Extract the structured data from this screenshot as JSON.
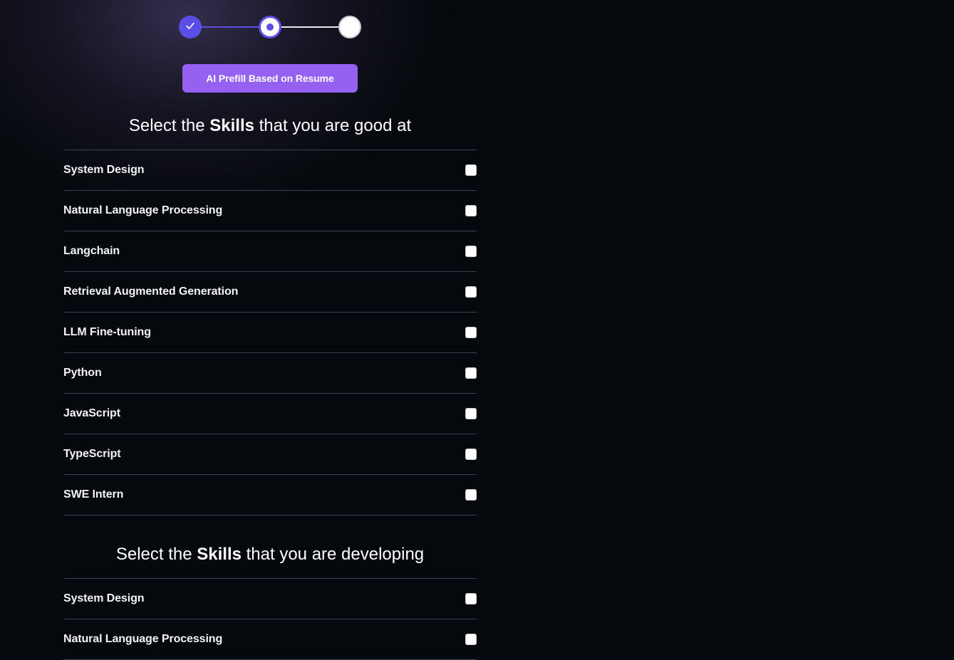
{
  "stepper": {
    "steps": [
      {
        "status": "complete",
        "icon": "check-icon"
      },
      {
        "status": "current",
        "icon": "dot-icon"
      },
      {
        "status": "upcoming",
        "icon": ""
      }
    ],
    "current_step": 2,
    "total_steps": 3
  },
  "prefill_button": {
    "label": "AI Prefill Based on Resume"
  },
  "colors": {
    "accent": "#5b4ee6",
    "button": "#9461f0",
    "background": "#05080c",
    "divider": "#3a4150"
  },
  "sections": [
    {
      "title_prefix": "Select the ",
      "title_bold": "Skills",
      "title_suffix": " that you are good at",
      "skills": [
        {
          "label": "System Design",
          "checked": false
        },
        {
          "label": "Natural Language Processing",
          "checked": false
        },
        {
          "label": "Langchain",
          "checked": false
        },
        {
          "label": "Retrieval Augmented Generation",
          "checked": false
        },
        {
          "label": "LLM Fine-tuning",
          "checked": false
        },
        {
          "label": "Python",
          "checked": false
        },
        {
          "label": "JavaScript",
          "checked": false
        },
        {
          "label": "TypeScript",
          "checked": false
        },
        {
          "label": "SWE Intern",
          "checked": false
        }
      ]
    },
    {
      "title_prefix": "Select the ",
      "title_bold": "Skills",
      "title_suffix": " that you are developing",
      "skills": [
        {
          "label": "System Design",
          "checked": false
        },
        {
          "label": "Natural Language Processing",
          "checked": false
        }
      ]
    }
  ]
}
